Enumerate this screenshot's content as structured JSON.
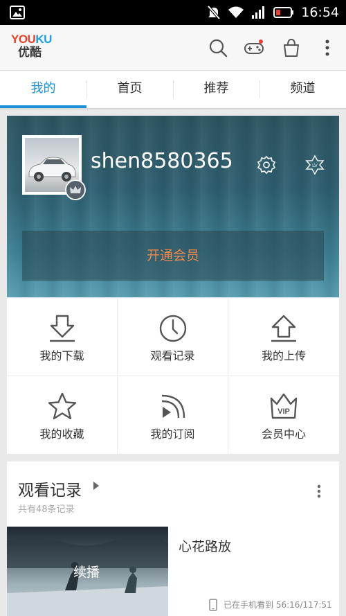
{
  "status_bar": {
    "time": "16:54"
  },
  "app": {
    "logo_en": "YOUKU",
    "logo_cn": "优酷"
  },
  "tabs": [
    {
      "label": "我的",
      "active": true
    },
    {
      "label": "首页",
      "active": false
    },
    {
      "label": "推荐",
      "active": false
    },
    {
      "label": "频道",
      "active": false
    }
  ],
  "profile": {
    "username": "shen8580365",
    "vip_button": "开通会员"
  },
  "grid": [
    {
      "label": "我的下载",
      "icon": "download-icon"
    },
    {
      "label": "观看记录",
      "icon": "clock-icon"
    },
    {
      "label": "我的上传",
      "icon": "upload-icon"
    },
    {
      "label": "我的收藏",
      "icon": "star-icon"
    },
    {
      "label": "我的订阅",
      "icon": "subscribe-icon"
    },
    {
      "label": "会员中心",
      "icon": "vip-crown-icon"
    }
  ],
  "vip_icon_text": "VIP",
  "history": {
    "title": "观看记录",
    "subtitle": "共有48条记录",
    "items": [
      {
        "title": "心花路放",
        "thumb_label": "续播",
        "meta": "已在手机看到 56:16/117:51"
      }
    ]
  },
  "colors": {
    "accent": "#1a91d9",
    "vip_orange": "#f08a4b",
    "logo_blue": "#1ea1e6",
    "logo_red": "#e8412c"
  }
}
